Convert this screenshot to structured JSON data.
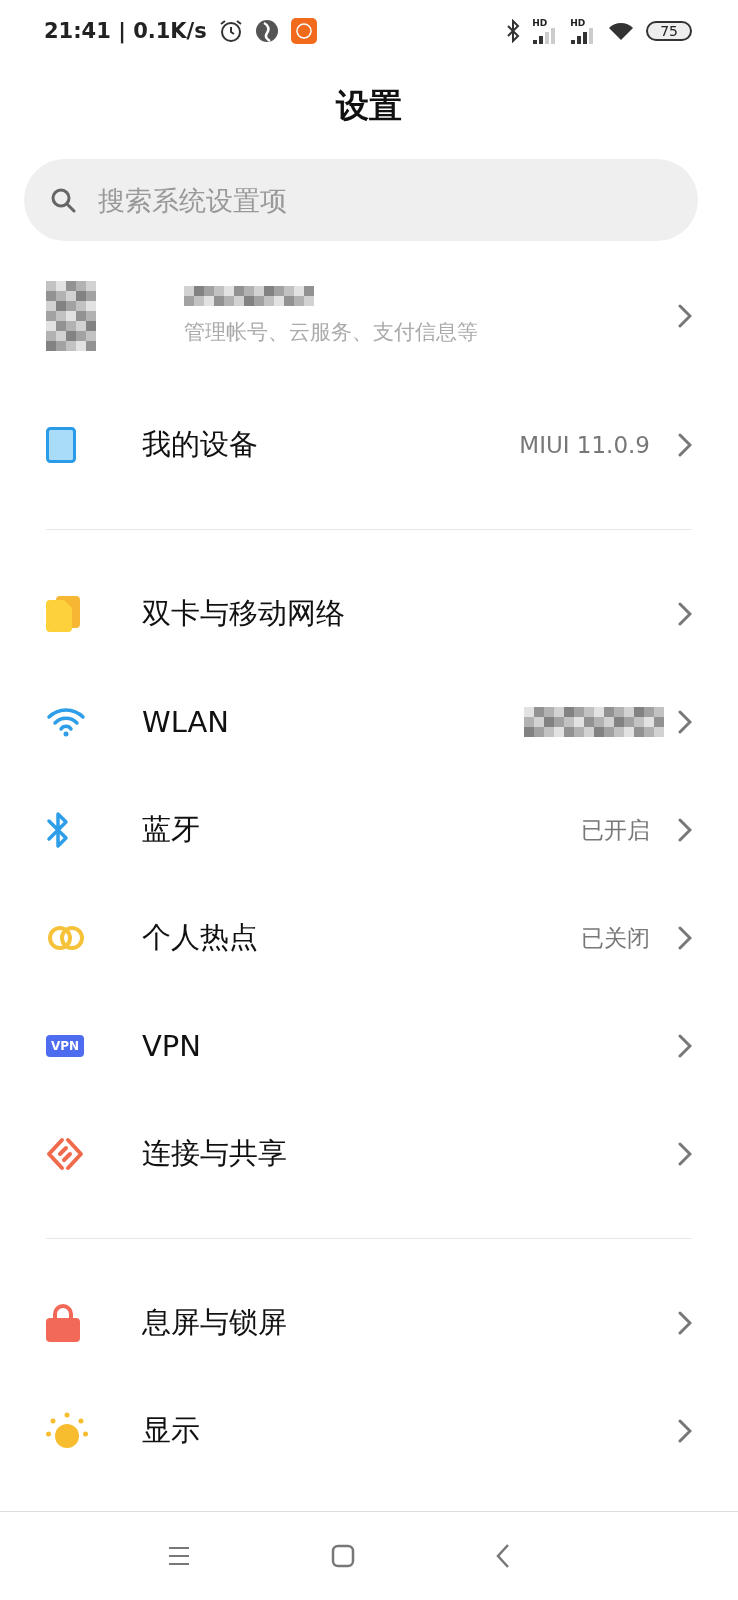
{
  "status_bar": {
    "time_speed": "21:41 | 0.1K/s",
    "signals": [
      {
        "label": "HD"
      },
      {
        "label": "HD"
      }
    ],
    "battery": "75"
  },
  "title": "设置",
  "search": {
    "placeholder": "搜索系统设置项"
  },
  "account": {
    "subtitle": "管理帐号、云服务、支付信息等"
  },
  "sections": [
    {
      "items": [
        {
          "kind": "device",
          "label": "我的设备",
          "value": "MIUI 11.0.9"
        }
      ]
    },
    {
      "items": [
        {
          "kind": "sim",
          "label": "双卡与移动网络"
        },
        {
          "kind": "wifi",
          "label": "WLAN",
          "value_redacted": true
        },
        {
          "kind": "bluetooth",
          "label": "蓝牙",
          "value": "已开启"
        },
        {
          "kind": "hotspot",
          "label": "个人热点",
          "value": "已关闭"
        },
        {
          "kind": "vpn",
          "icon_text": "VPN",
          "label": "VPN"
        },
        {
          "kind": "share",
          "label": "连接与共享"
        }
      ]
    },
    {
      "items": [
        {
          "kind": "lock",
          "label": "息屏与锁屏"
        },
        {
          "kind": "sun",
          "label": "显示"
        }
      ]
    }
  ]
}
